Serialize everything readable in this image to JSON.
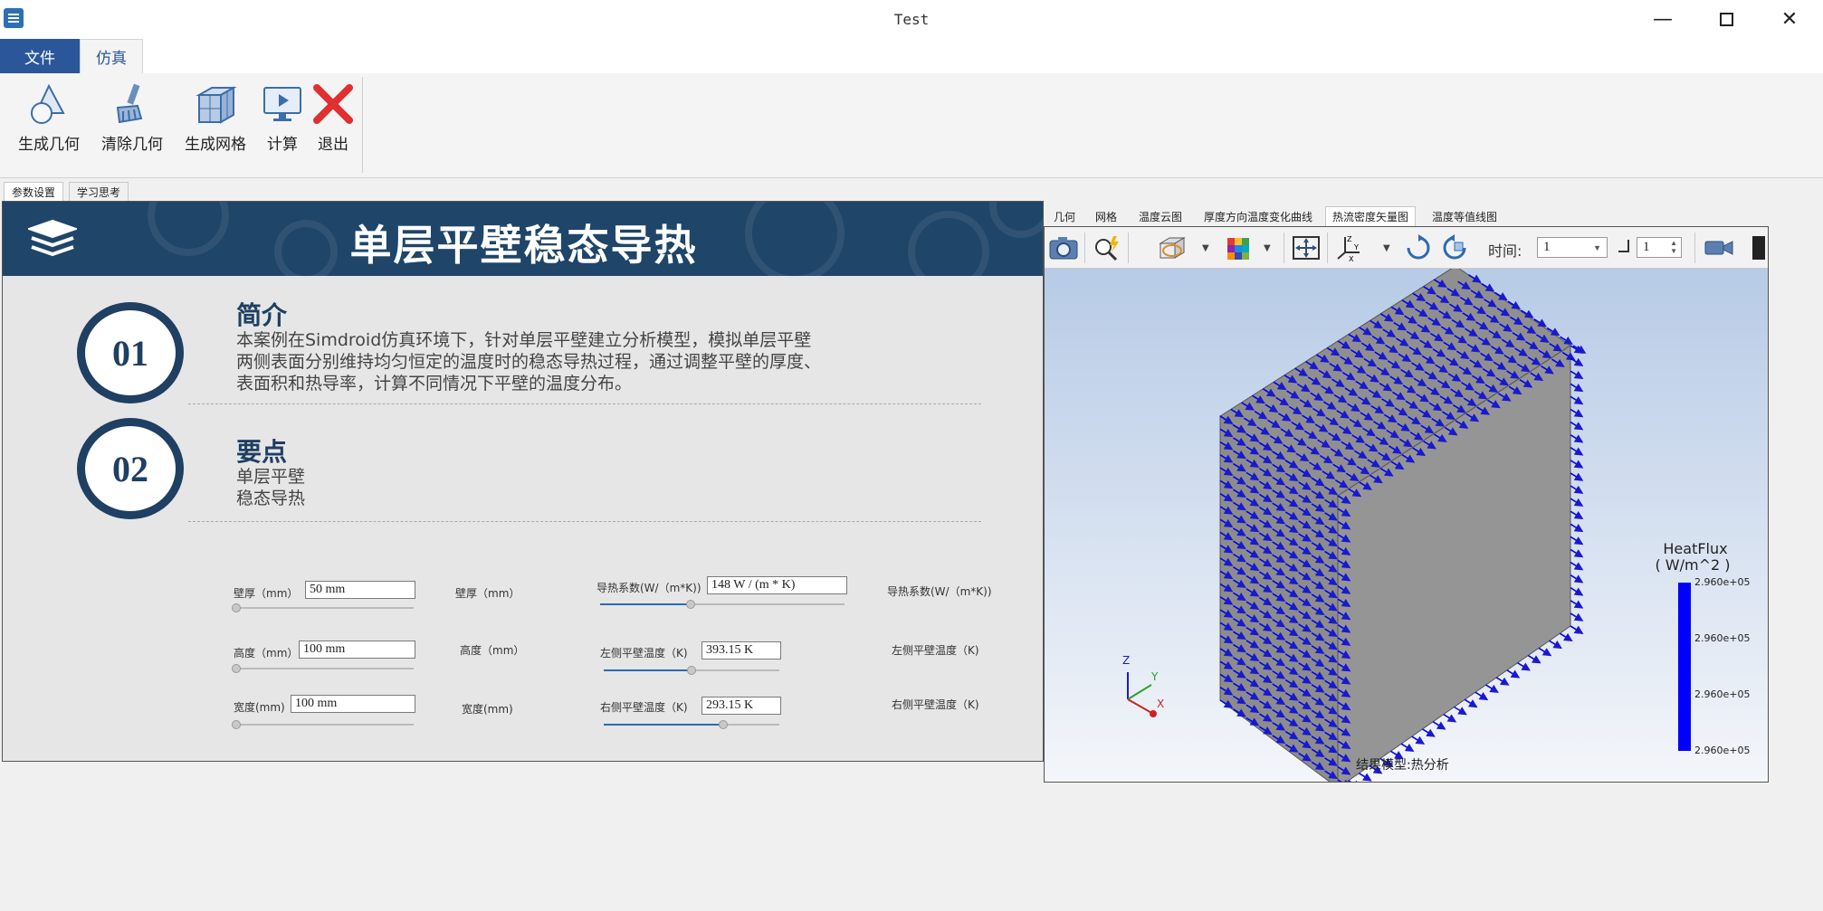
{
  "window": {
    "title": "Test"
  },
  "menu": {
    "file": "文件",
    "simulation": "仿真"
  },
  "ribbon": {
    "buttons": [
      {
        "label": "生成几何",
        "icon": "shapes-icon"
      },
      {
        "label": "清除几何",
        "icon": "brush-icon"
      },
      {
        "label": "生成网格",
        "icon": "mesh-cube-icon"
      },
      {
        "label": "计算",
        "icon": "monitor-play-icon"
      },
      {
        "label": "退出",
        "icon": "red-x-icon"
      }
    ]
  },
  "panel_tabs": [
    "参数设置",
    "学习思考"
  ],
  "banner": {
    "title": "单层平壁稳态导热"
  },
  "sections": [
    {
      "num": "01",
      "heading": "简介",
      "lines": [
        "本案例在Simdroid仿真环境下，针对单层平壁建立分析模型，模拟单层平壁",
        "两侧表面分别维持均匀恒定的温度时的稳态导热过程，通过调整平壁的厚度、",
        "表面积和热导率，计算不同情况下平壁的温度分布。"
      ]
    },
    {
      "num": "02",
      "heading": "要点",
      "lines": [
        "单层平壁",
        "稳态导热"
      ]
    }
  ],
  "params": {
    "thickness": {
      "label": "壁厚（mm）",
      "value": "50 mm",
      "right_label": "壁厚（mm）",
      "slider": 0.0
    },
    "height": {
      "label": "高度（mm）",
      "value": "100 mm",
      "right_label": "高度（mm）",
      "slider": 0.0
    },
    "width": {
      "label": "宽度(mm)",
      "value": "100 mm",
      "right_label": "宽度(mm)",
      "slider": 0.0
    },
    "conductivity": {
      "label": "导热系数(W/（m*K))",
      "value": "148 W / (m * K)",
      "right_label": "导热系数(W/（m*K))",
      "slider": 0.37
    },
    "left_temp": {
      "label": "左侧平壁温度（K)",
      "value": "393.15 K",
      "right_label": "左侧平壁温度（K)",
      "slider": 0.5
    },
    "right_temp": {
      "label": "右侧平壁温度（K)",
      "value": "293.15 K",
      "right_label": "右侧平壁温度（K)",
      "slider": 0.68
    }
  },
  "viewer_tabs": [
    "几何",
    "网格",
    "温度云图",
    "厚度方向温度变化曲线",
    "热流密度矢量图",
    "温度等值线图"
  ],
  "viewer_active_tab": "热流密度矢量图",
  "toolbar": {
    "time_label": "时间:",
    "time_value": "1",
    "step_value": "1"
  },
  "legend": {
    "title": "HeatFlux",
    "unit": "( W/m^2 )",
    "values": [
      "2.960e+05",
      "2.960e+05",
      "2.960e+05",
      "2.960e+05"
    ],
    "color": "#0000ff"
  },
  "axes": {
    "x": "X",
    "y": "Y",
    "z": "Z"
  },
  "model_caption": "结果模型:热分析"
}
